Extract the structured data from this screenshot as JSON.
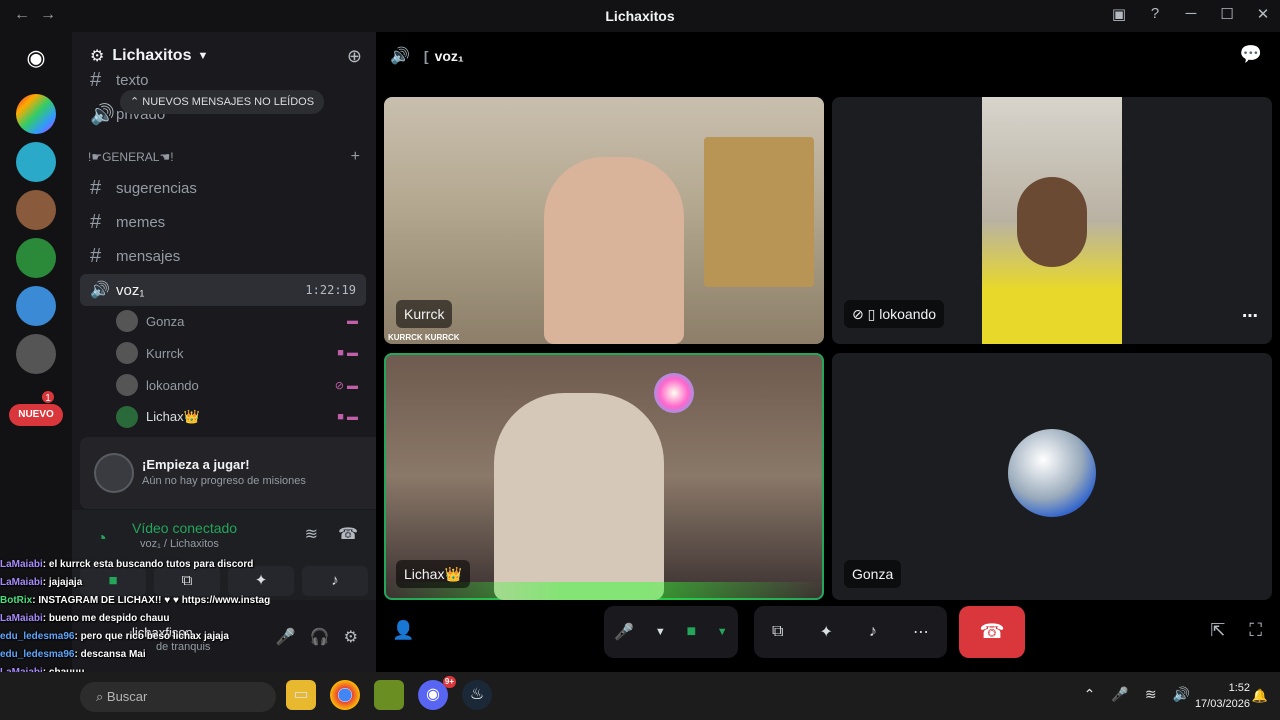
{
  "window": {
    "title": "Lichaxitos",
    "back": "←",
    "forward": "→"
  },
  "rail": {
    "nuevo_label": "NUEVO",
    "mention_count": "1"
  },
  "sidebar": {
    "guild_name": "Lichaxitos",
    "partial_top_1": "texto",
    "partial_top_2": "privado",
    "new_messages_pill": "NUEVOS MENSAJES NO LEÍDOS",
    "category": "!☛GENERAL☚!",
    "channels": [
      {
        "label": "sugerencias",
        "type": "text"
      },
      {
        "label": "memes",
        "type": "text"
      },
      {
        "label": "mensajes",
        "type": "text"
      },
      {
        "label": "voz₁",
        "type": "voice",
        "time": "1:22:19"
      }
    ],
    "voice_users": [
      {
        "name": "Gonza"
      },
      {
        "name": "Kurrck"
      },
      {
        "name": "lokoando"
      },
      {
        "name": "Lichax👑"
      }
    ]
  },
  "quest": {
    "title": "¡Empieza a jugar!",
    "subtitle": "Aún no hay progreso de misiones"
  },
  "voice_connection": {
    "status": "Vídeo conectado",
    "channel": "voz₁ / Lichaxitos"
  },
  "userbar": {
    "username": "lichaxfison",
    "status": "de tranquis"
  },
  "main": {
    "channel_name": "voz₁",
    "tiles": [
      {
        "name": "Kurrck",
        "watermark": "KURRCK KURRCK"
      },
      {
        "name": "lokoando"
      },
      {
        "name": "Lichax👑"
      },
      {
        "name": "Gonza"
      }
    ]
  },
  "chat_overlay": [
    {
      "user": "LaMaiabi",
      "text": ": el kurrck esta buscando tutos para discord"
    },
    {
      "user": "LaMaiabi",
      "text": ": jajajaja"
    },
    {
      "user": "BotRix",
      "text": ": INSTAGRAM DE LICHAX!! ♥ ♥ https://www.instagram.com/elLichax"
    },
    {
      "user": "LaMaiabi",
      "text": ": bueno me despido chauu"
    },
    {
      "user": "edu_ledesma96",
      "text": ": pero que rico beso lichax jajaja"
    },
    {
      "user": "edu_ledesma96",
      "text": ": descansa Mai"
    },
    {
      "user": "LaMaiabi",
      "text": ": chauuu"
    }
  ],
  "taskbar": {
    "search_placeholder": "Buscar",
    "time": "1:52",
    "date": "17/03/2026",
    "discord_badge": "9+"
  },
  "colors": {
    "green": "#23a55a",
    "red": "#da373c",
    "pink": "#c160a8"
  }
}
